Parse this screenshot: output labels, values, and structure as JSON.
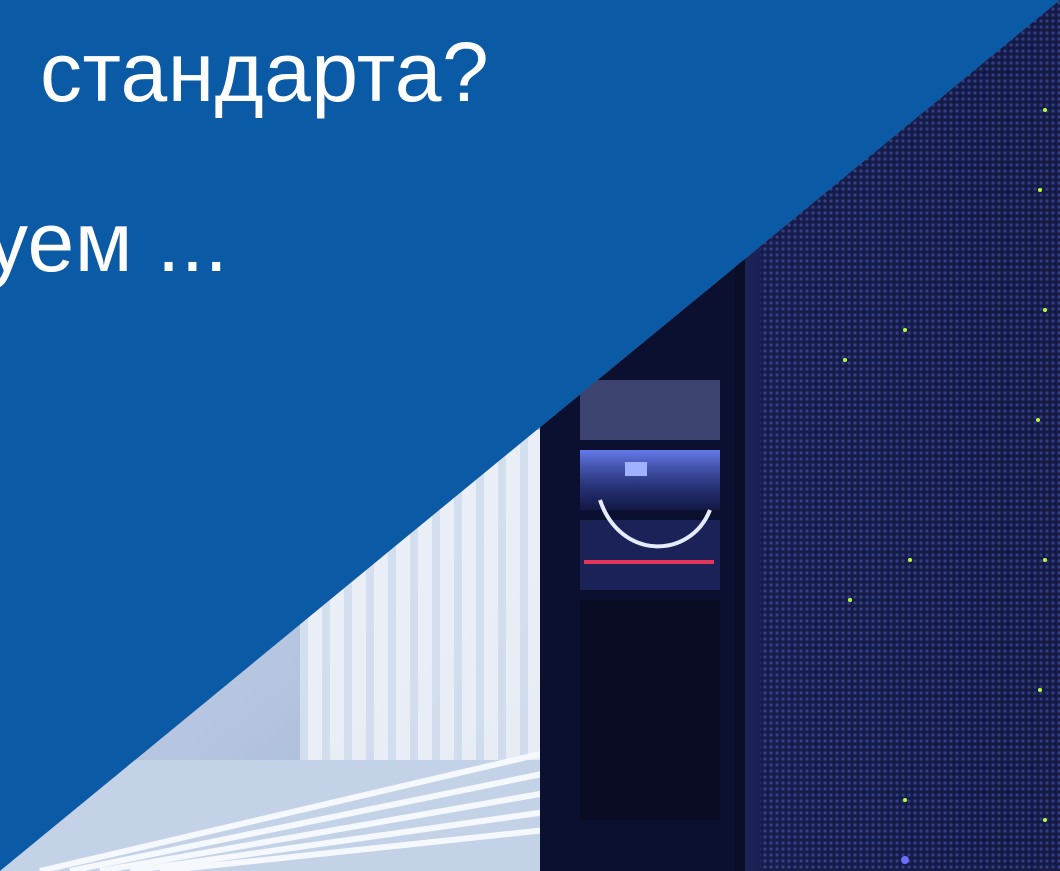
{
  "headline": {
    "line1": "стандарта?",
    "line2": "уем ..."
  },
  "colors": {
    "background": "#0b5aa5",
    "text": "#ffffff",
    "server_dark": "#12163a",
    "server_light": "#c9d6ea",
    "led": "#b6ff3b"
  },
  "image": {
    "subject": "server-racks-photo"
  }
}
